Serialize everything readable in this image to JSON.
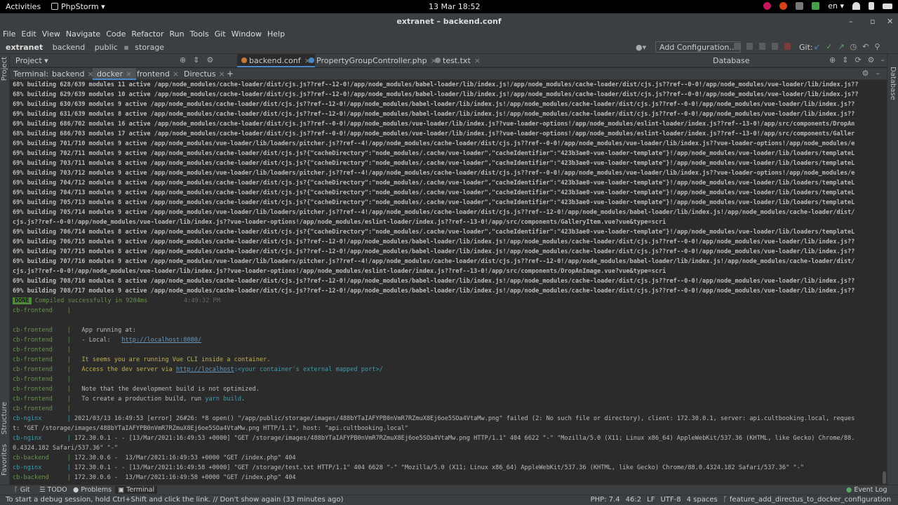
{
  "gnome": {
    "activities": "Activities",
    "app_name": "PhpStorm",
    "app_caret": "▾",
    "clock": "13 Mar  18:52",
    "language": "en",
    "language_caret": "▾"
  },
  "window": {
    "title": "extranet – backend.conf",
    "minimize": "–",
    "restore": "▫",
    "close": "✕"
  },
  "menu": [
    "File",
    "Edit",
    "View",
    "Navigate",
    "Code",
    "Refactor",
    "Run",
    "Tools",
    "Git",
    "Window",
    "Help"
  ],
  "breadcrumb": [
    "extranet",
    "backend",
    "public",
    "storage"
  ],
  "toolbar": {
    "add_configuration": "Add Configuration...",
    "git_label": "Git:"
  },
  "tool_tabs": {
    "project": "Project",
    "project_caret": "▾",
    "database": "Database"
  },
  "editor_tabs": [
    {
      "label": "backend.conf",
      "color": "#c77d3a"
    },
    {
      "label": "PropertyGroupController.php",
      "color": "#4a88c7"
    },
    {
      "label": "test.txt",
      "color": "#888888"
    }
  ],
  "terminal": {
    "title": "Terminal:",
    "tabs": [
      "backend",
      "docker",
      "frontend",
      "Directus"
    ],
    "active_tab": "docker",
    "plus": "+",
    "build_lines": [
      "68% building 628/639 modules 11 active /app/node_modules/cache-loader/dist/cjs.js??ref--12-0!/app/node_modules/babel-loader/lib/index.js!/app/node_modules/cache-loader/dist/cjs.js??ref--0-0!/app/node_modules/vue-loader/lib/index.js??",
      "68% building 629/639 modules 10 active /app/node_modules/cache-loader/dist/cjs.js??ref--12-0!/app/node_modules/babel-loader/lib/index.js!/app/node_modules/cache-loader/dist/cjs.js??ref--0-0!/app/node_modules/vue-loader/lib/index.js??",
      "69% building 630/639 modules 9 active /app/node_modules/cache-loader/dist/cjs.js??ref--12-0!/app/node_modules/babel-loader/lib/index.js!/app/node_modules/cache-loader/dist/cjs.js??ref--0-0!/app/node_modules/vue-loader/lib/index.js??",
      "69% building 631/639 modules 8 active /app/node_modules/cache-loader/dist/cjs.js??ref--12-0!/app/node_modules/babel-loader/lib/index.js!/app/node_modules/cache-loader/dist/cjs.js??ref--0-0!/app/node_modules/vue-loader/lib/index.js??",
      "69% building 686/702 modules 16 active /app/node_modules/cache-loader/dist/cjs.js??ref--0-0!/app/node_modules/vue-loader/lib/index.js??vue-loader-options!/app/node_modules/eslint-loader/index.js??ref--13-0!/app/src/components/DropAn",
      "68% building 686/703 modules 17 active /app/node_modules/cache-loader/dist/cjs.js??ref--0-0!/app/node_modules/vue-loader/lib/index.js??vue-loader-options!/app/node_modules/eslint-loader/index.js??ref--13-0!/app/src/components/Galler",
      "69% building 701/710 modules 9 active /app/node_modules/vue-loader/lib/loaders/pitcher.js??ref--4!/app/node_modules/cache-loader/dist/cjs.js??ref--0-0!/app/node_modules/vue-loader/lib/index.js??vue-loader-options!/app/node_modules/e",
      "69% building 702/711 modules 9 active /app/node_modules/cache-loader/dist/cjs.js?{\"cacheDirectory\":\"node_modules/.cache/vue-loader\",\"cacheIdentifier\":\"423b3ae0-vue-loader-template\"}!/app/node_modules/vue-loader/lib/loaders/templateL",
      "69% building 703/711 modules 8 active /app/node_modules/cache-loader/dist/cjs.js?{\"cacheDirectory\":\"node_modules/.cache/vue-loader\",\"cacheIdentifier\":\"423b3ae0-vue-loader-template\"}!/app/node_modules/vue-loader/lib/loaders/templateL",
      "69% building 703/712 modules 9 active /app/node_modules/vue-loader/lib/loaders/pitcher.js??ref--4!/app/node_modules/cache-loader/dist/cjs.js??ref--0-0!/app/node_modules/vue-loader/lib/index.js??vue-loader-options!/app/node_modules/e",
      "69% building 704/712 modules 8 active /app/node_modules/cache-loader/dist/cjs.js?{\"cacheDirectory\":\"node_modules/.cache/vue-loader\",\"cacheIdentifier\":\"423b3ae0-vue-loader-template\"}!/app/node_modules/vue-loader/lib/loaders/templateL",
      "69% building 704/713 modules 9 active /app/node_modules/cache-loader/dist/cjs.js?{\"cacheDirectory\":\"node_modules/.cache/vue-loader\",\"cacheIdentifier\":\"423b3ae0-vue-loader-template\"}!/app/node_modules/vue-loader/lib/loaders/templateL",
      "69% building 705/713 modules 8 active /app/node_modules/cache-loader/dist/cjs.js?{\"cacheDirectory\":\"node_modules/.cache/vue-loader\",\"cacheIdentifier\":\"423b3ae0-vue-loader-template\"}!/app/node_modules/vue-loader/lib/loaders/templateL",
      "69% building 705/714 modules 9 active /app/node_modules/vue-loader/lib/loaders/pitcher.js??ref--4!/app/node_modules/cache-loader/dist/cjs.js??ref--12-0!/app/node_modules/babel-loader/lib/index.js!/app/node_modules/cache-loader/dist/",
      "cjs.js??ref--0-0!/app/node_modules/vue-loader/lib/index.js??vue-loader-options!/app/node_modules/eslint-loader/index.js??ref--13-0!/app/src/components/GalleryItem.vue?vue&type=scri",
      "69% building 706/714 modules 8 active /app/node_modules/cache-loader/dist/cjs.js?{\"cacheDirectory\":\"node_modules/.cache/vue-loader\",\"cacheIdentifier\":\"423b3ae0-vue-loader-template\"}!/app/node_modules/vue-loader/lib/loaders/templateL",
      "69% building 706/715 modules 9 active /app/node_modules/cache-loader/dist/cjs.js??ref--12-0!/app/node_modules/babel-loader/lib/index.js!/app/node_modules/cache-loader/dist/cjs.js??ref--0-0!/app/node_modules/vue-loader/lib/index.js??",
      "69% building 707/715 modules 8 active /app/node_modules/cache-loader/dist/cjs.js??ref--12-0!/app/node_modules/babel-loader/lib/index.js!/app/node_modules/cache-loader/dist/cjs.js??ref--0-0!/app/node_modules/vue-loader/lib/index.js??",
      "69% building 707/716 modules 9 active /app/node_modules/vue-loader/lib/loaders/pitcher.js??ref--4!/app/node_modules/cache-loader/dist/cjs.js??ref--12-0!/app/node_modules/babel-loader/lib/index.js!/app/node_modules/cache-loader/dist/",
      "cjs.js??ref--0-0!/app/node_modules/vue-loader/lib/index.js??vue-loader-options!/app/node_modules/eslint-loader/index.js??ref--13-0!/app/src/components/DropAnImage.vue?vue&type=scri",
      "69% building 708/716 modules 8 active /app/node_modules/cache-loader/dist/cjs.js??ref--12-0!/app/node_modules/babel-loader/lib/index.js!/app/node_modules/cache-loader/dist/cjs.js??ref--0-0!/app/node_modules/vue-loader/lib/index.js??",
      "69% building 708/717 modules 9 active /app/node_modules/cache-loader/dist/cjs.js??ref--12-0!/app/node_modules/babel-loader/lib/index.js!/app/node_modules/cache-loader/dist/cjs.js??ref--0-0!/app/node_modules/vue-loader/lib/index.js??"
    ],
    "done_badge": "DONE",
    "done_text": "Compiled successfully in 9204ms",
    "done_time": "4:49:32 PM",
    "frontend_prefix": "cb-frontend",
    "nginx_prefix": "cb-nginx",
    "backend_prefix": "cb-backend",
    "pipe": "|",
    "app_running": "App running at:",
    "local_label": "- Local:",
    "local_url": "http://localhost:8080/",
    "container_note": "It seems you are running Vue CLI inside a container.",
    "access_prefix": "Access the dev server via ",
    "access_url": "http://localhost",
    "access_suffix": ":<your container's external mapped port>/",
    "dev_build_note": "Note that the development build is not optimized.",
    "prod_prefix": "To create a production build, run ",
    "prod_cmd": "yarn build",
    "prod_suffix": ".",
    "log_lines": [
      {
        "prefix": "cb-nginx",
        "text": "2021/03/13 16:49:53 [error] 26#26: *8 open() \"/app/public/storage/images/488bYTaIAFYPB0nVmR7RZmuX8Ej6oe5SOa4VtaMw.png\" failed (2: No such file or directory), client: 172.30.0.1, server: api.cultbooking.local, reques"
      },
      {
        "prefix": "",
        "text": "t: \"GET /storage/images/488bYTaIAFYPB0nVmR7RZmuX8Ej6oe5SOa4VtaMw.png HTTP/1.1\", host: \"api.cultbooking.local\""
      },
      {
        "prefix": "cb-nginx",
        "text": "172.30.0.1 - - [13/Mar/2021:16:49:53 +0000] \"GET /storage/images/488bYTaIAFYPB0nVmR7RZmuX8Ej6oe5SOa4VtaMw.png HTTP/1.1\" 404 6622 \"-\" \"Mozilla/5.0 (X11; Linux x86_64) AppleWebKit/537.36 (KHTML, like Gecko) Chrome/88."
      },
      {
        "prefix": "",
        "text": "0.4324.182 Safari/537.36\" \"-\""
      },
      {
        "prefix": "cb-backend",
        "text": "172.30.0.6 -  13/Mar/2021:16:49:53 +0000 \"GET /index.php\" 404"
      },
      {
        "prefix": "cb-nginx",
        "text": "172.30.0.1 - - [13/Mar/2021:16:49:58 +0000] \"GET /storage/test.txt HTTP/1.1\" 404 6628 \"-\" \"Mozilla/5.0 (X11; Linux x86_64) AppleWebKit/537.36 (KHTML, like Gecko) Chrome/88.0.4324.182 Safari/537.36\" \"-\""
      },
      {
        "prefix": "cb-backend",
        "text": "172.30.0.6 -  13/Mar/2021:16:49:58 +0000 \"GET /index.php\" 404"
      }
    ]
  },
  "side_labels": {
    "project": "Project",
    "structure": "Structure",
    "favorites": "Favorites",
    "database": "Database"
  },
  "bottom_tools": {
    "git": "Git",
    "todo": "TODO",
    "problems": "Problems",
    "terminal": "Terminal",
    "event_log": "Event Log"
  },
  "status": {
    "message": "To start a debug session, hold Ctrl+Shift and click the link. // Don't show again (33 minutes ago)",
    "php": "PHP: 7.4",
    "position": "46:2",
    "line_ending": "LF",
    "encoding": "UTF-8",
    "indent": "4 spaces",
    "branch": "feature_add_directus_to_docker_configuration"
  }
}
